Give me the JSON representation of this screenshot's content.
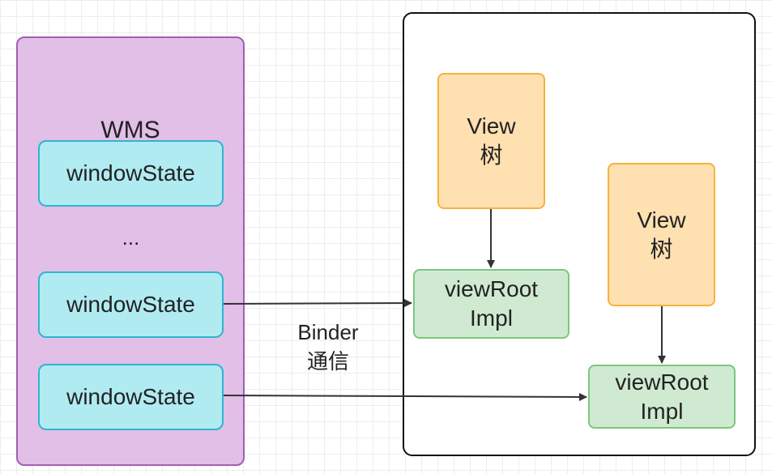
{
  "wms": {
    "title": "WMS",
    "window_states": [
      "windowState",
      "windowState",
      "windowState"
    ],
    "ellipsis": "..."
  },
  "app": {
    "views": [
      {
        "line1": "View",
        "line2": "树"
      },
      {
        "line1": "View",
        "line2": "树"
      }
    ],
    "view_root_impls": [
      {
        "line1": "viewRoot",
        "line2": "Impl"
      },
      {
        "line1": "viewRoot",
        "line2": "Impl"
      }
    ]
  },
  "connector": {
    "line1": "Binder",
    "line2": "通信"
  },
  "colors": {
    "wms_fill": "#e1bfe7",
    "window_state_fill": "#b0ebf1",
    "view_fill": "#ffe0b1",
    "view_root_impl_fill": "#d0ead1",
    "arrow": "#333333"
  }
}
